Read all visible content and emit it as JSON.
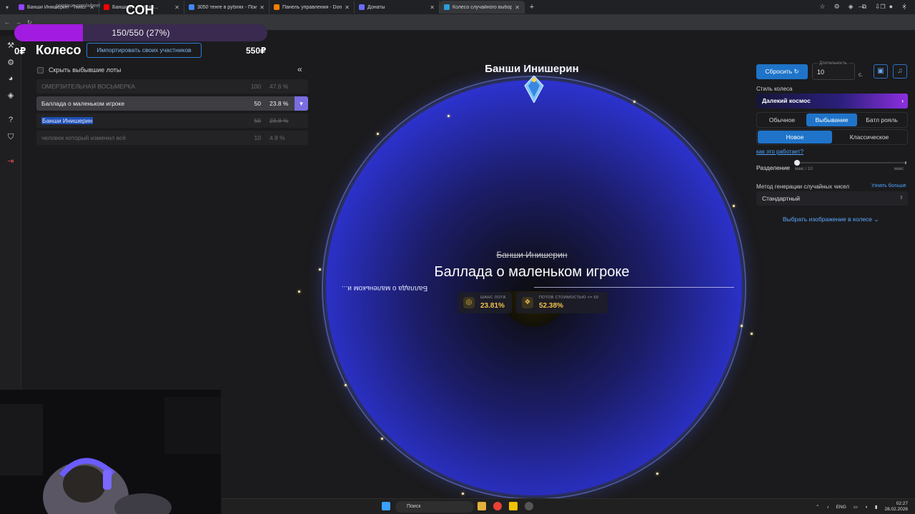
{
  "browser": {
    "tabs": [
      {
        "title": "Банши Инишерин - Twitch",
        "color": "#9146ff",
        "active": false
      },
      {
        "title": "Банши И... Русски...",
        "color": "#ff0000",
        "active": false
      },
      {
        "title": "3050 тенге в рублях - Поиск в...",
        "color": "#4285f4",
        "active": false
      },
      {
        "title": "Панель управления - Donati...",
        "color": "#f57d07",
        "active": false
      },
      {
        "title": "Донаты",
        "color": "#6b6bff",
        "active": false
      },
      {
        "title": "Колесо случайного выбора - ...",
        "color": "#2d9cdb",
        "active": true
      }
    ],
    "url": "pointauc.com/wheel"
  },
  "stream_overlay": {
    "goal_text": "150/550 (27%)",
    "goal_fraction": 0.27,
    "label": "СОН"
  },
  "sidebar": {
    "balance": "0₽"
  },
  "lots_panel": {
    "title": "Колесо",
    "import_label": "Импортировать своих участников",
    "total": "550₽",
    "hide_label": "Скрыть выбывшие лоты",
    "collapse_icon": "«",
    "lots": [
      {
        "name": "омерзительная восьмерка",
        "amount": "100",
        "percent": "47.6 %",
        "state": "out"
      },
      {
        "name": "Баллада о маленьком игроке",
        "amount": "50",
        "percent": "23.8 %",
        "state": "current"
      },
      {
        "name": "Банши Инишерин",
        "amount": "50",
        "percent": "23.8 %",
        "state": "sel"
      },
      {
        "name": "человек который изменил всё",
        "amount": "10",
        "percent": "4.8 %",
        "state": "out"
      }
    ]
  },
  "wheel": {
    "title": "Банши Инишерин",
    "mirror_label": "Баллада о маленьком и...",
    "previous_winner": "Банши Инишерин",
    "current": "Баллада о маленьком игроке",
    "stats": [
      {
        "label": "ШАНС ЛОТА",
        "value": "23.81%",
        "icon": "target-icon"
      },
      {
        "label": "ПОТОВ СТОИМОСТЬЮ <= 50",
        "value": "52.38%",
        "icon": "coins-icon"
      }
    ]
  },
  "settings": {
    "reset_label": "Сбросить",
    "duration_label": "Длительность",
    "duration_value": "10",
    "duration_unit": "с.",
    "wheel_style_label": "Стиль колеса",
    "wheel_style_value": "Далекий космос",
    "modes": [
      "Обычное",
      "Выбывание",
      "Батл рояль"
    ],
    "active_mode": 1,
    "variants": [
      "Новое",
      "Классическое"
    ],
    "active_variant": 0,
    "how_link": "как это работает?",
    "split_label": "Разделение",
    "split_min": "макс / 10",
    "split_max": "макс",
    "rng_label": "Метод генерации случайных чисел",
    "rng_more": "Узнать больше",
    "rng_value": "Стандартный",
    "image_pick": "Выбрать изображение в колесе"
  },
  "taskbar": {
    "search": "Поиск",
    "lang": "ENG",
    "time": "02:27",
    "date": "28.02.2026"
  }
}
